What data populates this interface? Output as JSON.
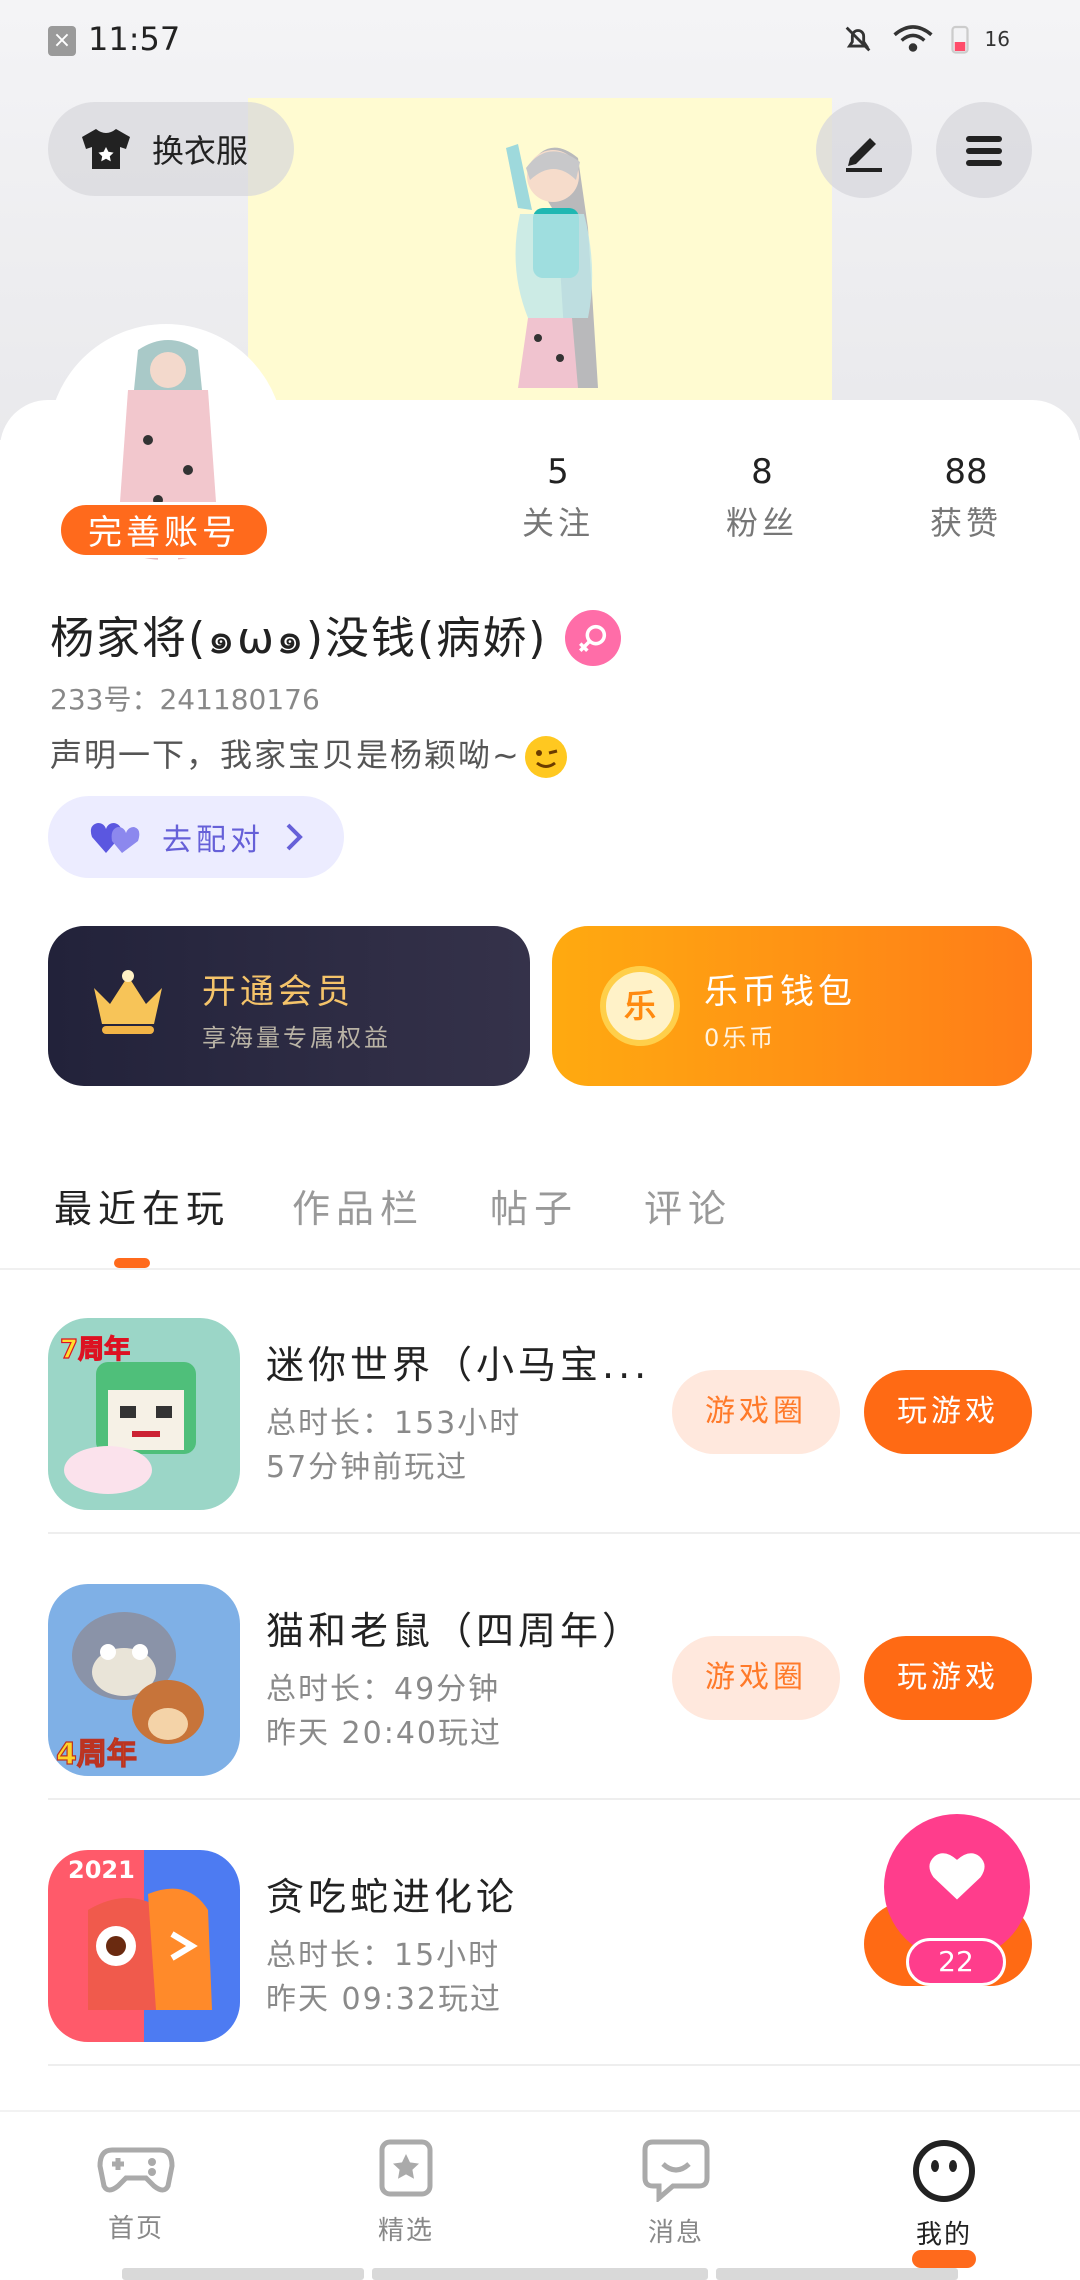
{
  "status_bar": {
    "time": "11:57",
    "battery": "16"
  },
  "header": {
    "outfit_label": "换衣服"
  },
  "profile": {
    "complete_label": "完善账号",
    "stats": [
      {
        "num": "5",
        "label": "关注"
      },
      {
        "num": "8",
        "label": "粉丝"
      },
      {
        "num": "88",
        "label": "获赞"
      }
    ],
    "nickname": "杨家将(๑ω๑)没钱(病娇)",
    "uid": "233号：241180176",
    "bio": "声明一下，我家宝贝是杨颖呦~",
    "match_label": "去配对"
  },
  "cards": {
    "vip_title": "开通会员",
    "vip_sub": "享海量专属权益",
    "wallet_coin": "乐",
    "wallet_title": "乐币钱包",
    "wallet_sub": "0乐币"
  },
  "tabs": [
    "最近在玩",
    "作品栏",
    "帖子",
    "评论"
  ],
  "games": [
    {
      "title": "迷你世界（小马宝...",
      "duration": "总时长：153小时",
      "last": "57分钟前玩过",
      "circle": "游戏圈",
      "play": "玩游戏",
      "badge": "7周年"
    },
    {
      "title": "猫和老鼠（四周年）",
      "duration": "总时长：49分钟",
      "last": "昨天 20:40玩过",
      "circle": "游戏圈",
      "play": "玩游戏",
      "badge": "4周年"
    },
    {
      "title": "贪吃蛇进化论",
      "duration": "总时长：15小时",
      "last": "昨天 09:32玩过",
      "circle": "",
      "play": "",
      "badge": "2021"
    }
  ],
  "floating_like": {
    "count": "22"
  },
  "bottom_nav": [
    "首页",
    "精选",
    "消息",
    "我的"
  ],
  "colors": {
    "accent": "#ff6a1c",
    "pink": "#ff3d8c",
    "vip_gold": "#f5c46a"
  }
}
